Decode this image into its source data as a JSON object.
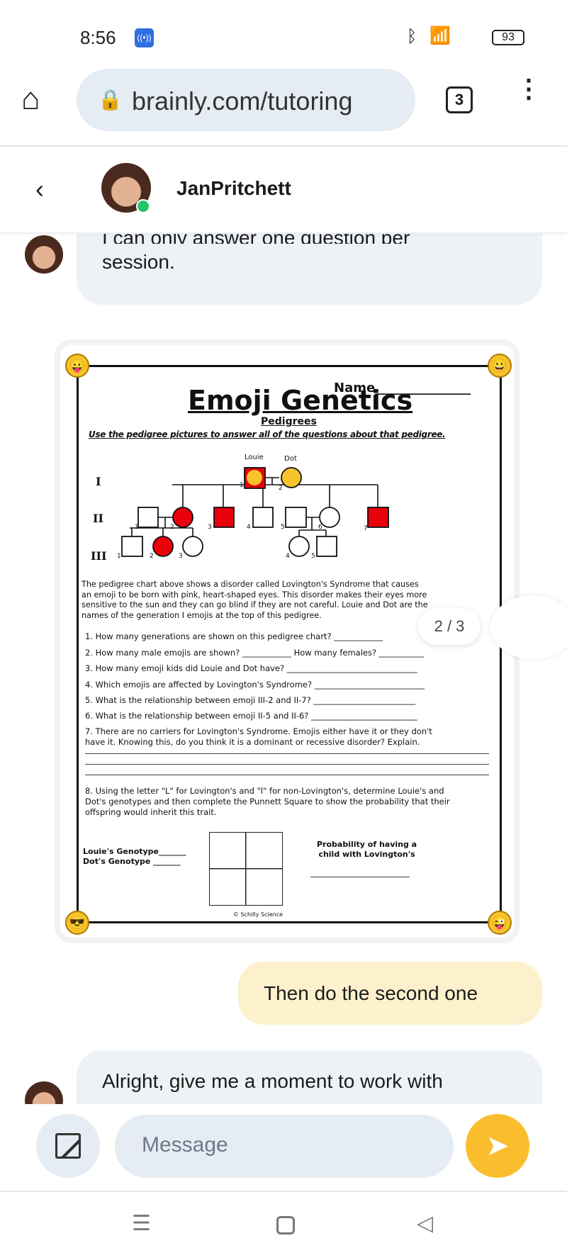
{
  "status": {
    "time": "8:56",
    "battery": "93"
  },
  "browser": {
    "url": "brainly.com/tutoring",
    "tab_count": "3"
  },
  "chat": {
    "tutor_name": "JanPritchett",
    "messages": [
      {
        "from": "tutor",
        "text_partial": "I can only answer one question per",
        "text": "session."
      },
      {
        "from": "user",
        "text": "Then do the second one"
      },
      {
        "from": "tutor",
        "text": "Alright, give me a moment to work with"
      }
    ],
    "image_pager": "2 / 3",
    "input_placeholder": "Message"
  },
  "worksheet": {
    "name_label": "Name_______________",
    "title": "Emoji Genetics",
    "subtitle": "Pedigrees",
    "instruction": "Use the pedigree pictures to answer all of the questions about that pedigree.",
    "gen_labels": [
      "I",
      "II",
      "III"
    ],
    "louie": "Louie",
    "dot": "Dot",
    "paragraph": [
      "The pedigree chart above shows a disorder called Lovington's Syndrome that causes",
      "an emoji to be born with pink, heart-shaped eyes.  This disorder makes their eyes more",
      "sensitive to the sun and they can go blind if they are not careful.  Louie and Dot are the",
      "names of the generation I emojis at the top of this pedigree."
    ],
    "questions": [
      "1. How many generations are shown on this pedigree chart? ____________",
      "2. How many male emojis are shown? ____________  How many females? ___________",
      "3. How many emoji kids did Louie and Dot have? ________________________________",
      "4. Which emojis are affected by Lovington's Syndrome? ___________________________",
      "5. What is the relationship between emoji III-2 and II-7? _________________________",
      "6. What is the relationship between emoji II-5 and II-6? __________________________",
      "7. There are no carriers for Lovington's Syndrome.  Emojis either have it or they don't",
      "have it.  Knowing this, do you think it is a dominant or recessive disorder? Explain.",
      "8. Using the letter \"L\" for Lovington's and \"l\" for non-Lovington's, determine Louie's and",
      "Dot's genotypes and then complete the Punnett Square to show the probability that their",
      "offspring would inherit this trait."
    ],
    "louie_genotype": "Louie's Genotype_______",
    "dot_genotype": "Dot's Genotype _______",
    "probability": [
      "Probability of having a",
      "child with Lovington's"
    ],
    "copyright": "© Schilly Science"
  },
  "colors": {
    "affected": "#e8000b",
    "send": "#f9bd2e",
    "user_bubble": "#fdf0cc",
    "tutor_bubble": "#eef2f6"
  }
}
